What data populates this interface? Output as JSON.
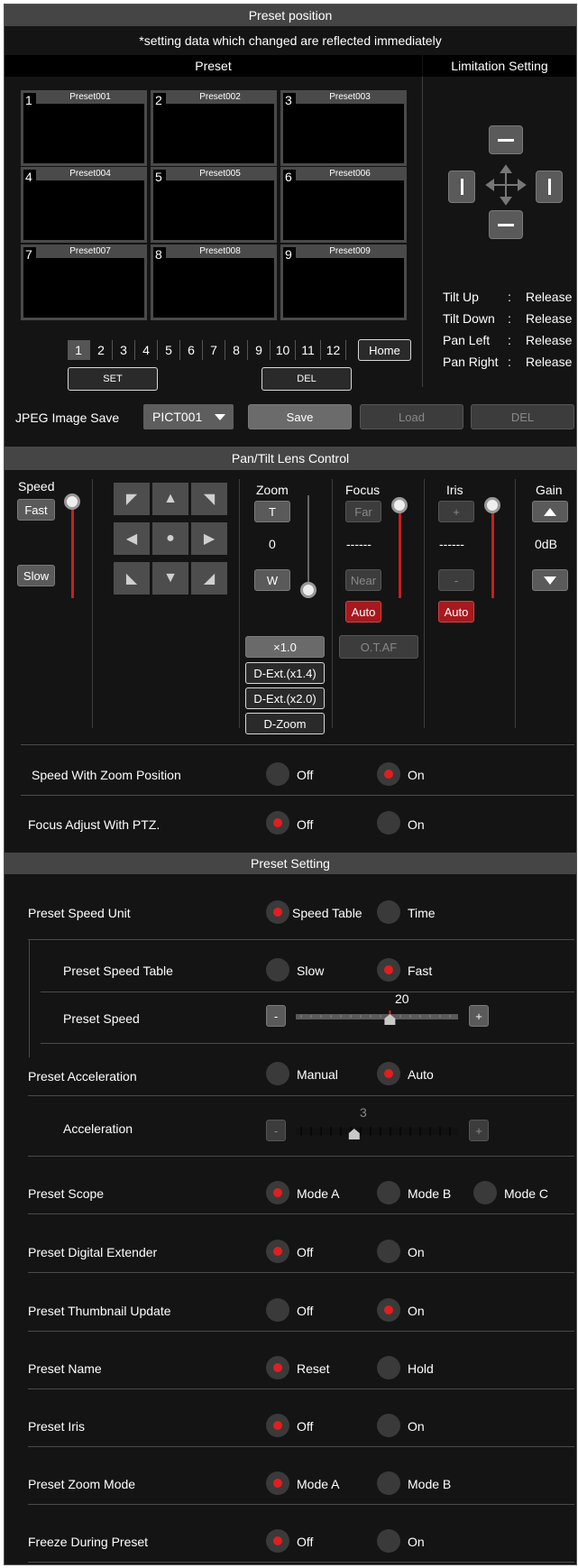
{
  "header": {
    "title": "Preset position",
    "notice": "*setting data which changed are reflected immediately"
  },
  "preset": {
    "title": "Preset",
    "thumbs": [
      {
        "num": "1",
        "name": "Preset001"
      },
      {
        "num": "2",
        "name": "Preset002"
      },
      {
        "num": "3",
        "name": "Preset003"
      },
      {
        "num": "4",
        "name": "Preset004"
      },
      {
        "num": "5",
        "name": "Preset005"
      },
      {
        "num": "6",
        "name": "Preset006"
      },
      {
        "num": "7",
        "name": "Preset007"
      },
      {
        "num": "8",
        "name": "Preset008"
      },
      {
        "num": "9",
        "name": "Preset009"
      }
    ],
    "pages": [
      "1",
      "2",
      "3",
      "4",
      "5",
      "6",
      "7",
      "8",
      "9",
      "10",
      "11",
      "12"
    ],
    "home": "Home",
    "set": "SET",
    "del": "DEL",
    "jpeg_label": "JPEG Image Save",
    "jpeg_value": "PICT001",
    "save": "Save",
    "load": "Load",
    "jpeg_del": "DEL"
  },
  "limitation": {
    "title": "Limitation Setting",
    "rows": [
      {
        "label": "Tilt Up",
        "sep": ":",
        "value": "Release"
      },
      {
        "label": "Tilt Down",
        "sep": ":",
        "value": "Release"
      },
      {
        "label": "Pan Left",
        "sep": ":",
        "value": "Release"
      },
      {
        "label": "Pan Right",
        "sep": ":",
        "value": "Release"
      }
    ]
  },
  "pantilt": {
    "title": "Pan/Tilt Lens Control",
    "speed": {
      "label": "Speed",
      "fast": "Fast",
      "slow": "Slow"
    },
    "zoom": {
      "label": "Zoom",
      "tele": "T",
      "value": "0",
      "wide": "W",
      "x1": "×1.0",
      "dext14": "D-Ext.(x1.4)",
      "dext20": "D-Ext.(x2.0)",
      "dzoom": "D-Zoom"
    },
    "focus": {
      "label": "Focus",
      "far": "Far",
      "value": "------",
      "near": "Near",
      "auto": "Auto",
      "otaf": "O.T.AF"
    },
    "iris": {
      "label": "Iris",
      "plus": "+",
      "value": "------",
      "minus": "-",
      "auto": "Auto"
    },
    "gain": {
      "label": "Gain",
      "value": "0dB"
    },
    "speed_zoom": {
      "label": "Speed With Zoom Position",
      "off": "Off",
      "on": "On",
      "selected": "On"
    },
    "focus_ptz": {
      "label": "Focus Adjust With PTZ.",
      "off": "Off",
      "on": "On",
      "selected": "Off"
    }
  },
  "preset_setting": {
    "title": "Preset Setting",
    "speed_unit": {
      "label": "Preset Speed Unit",
      "opt1": "Speed Table",
      "opt2": "Time",
      "selected": "Speed Table"
    },
    "speed_table": {
      "label": "Preset Speed Table",
      "opt1": "Slow",
      "opt2": "Fast",
      "selected": "Fast"
    },
    "speed": {
      "label": "Preset Speed",
      "value": "20",
      "minus": "-",
      "plus": "+"
    },
    "acceleration_mode": {
      "label": "Preset Acceleration",
      "opt1": "Manual",
      "opt2": "Auto",
      "selected": "Auto"
    },
    "acceleration": {
      "label": "Acceleration",
      "value": "3",
      "minus": "-",
      "plus": "+"
    },
    "scope": {
      "label": "Preset Scope",
      "opt1": "Mode A",
      "opt2": "Mode B",
      "opt3": "Mode C",
      "selected": "Mode A"
    },
    "digital_ext": {
      "label": "Preset Digital Extender",
      "opt1": "Off",
      "opt2": "On",
      "selected": "Off"
    },
    "thumb_update": {
      "label": "Preset Thumbnail Update",
      "opt1": "Off",
      "opt2": "On",
      "selected": "On"
    },
    "name": {
      "label": "Preset Name",
      "opt1": "Reset",
      "opt2": "Hold",
      "selected": "Reset"
    },
    "iris": {
      "label": "Preset Iris",
      "opt1": "Off",
      "opt2": "On",
      "selected": "Off"
    },
    "zoom_mode": {
      "label": "Preset Zoom Mode",
      "opt1": "Mode A",
      "opt2": "Mode B",
      "selected": "Mode A"
    },
    "freeze": {
      "label": "Freeze During Preset",
      "opt1": "Off",
      "opt2": "On",
      "selected": "Off"
    }
  },
  "icons": {
    "move": "move-cross-icon",
    "center": "center-dot-icon"
  },
  "colors": {
    "accent": "#e21e1e",
    "panel": "#141414",
    "header": "#454545"
  }
}
